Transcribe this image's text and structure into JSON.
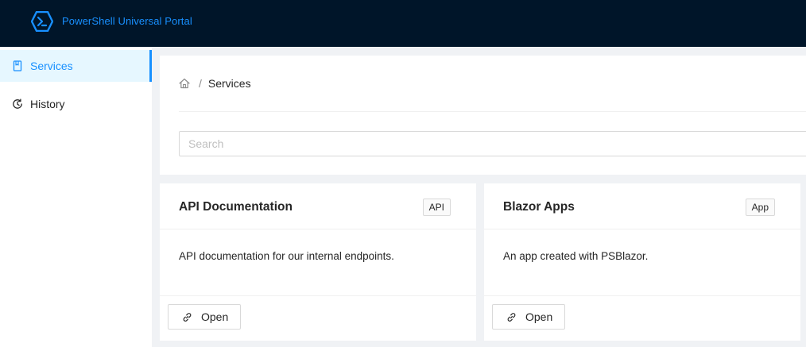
{
  "header": {
    "app_title": "PowerShell Universal Portal",
    "logo_icon": "powershell-hexagon-icon",
    "brand_color": "#1890ff",
    "background_color": "#001529"
  },
  "sidebar": {
    "items": [
      {
        "label": "Services",
        "icon": "book-icon",
        "active": true
      },
      {
        "label": "History",
        "icon": "history-icon",
        "active": false
      }
    ]
  },
  "breadcrumb": {
    "home_icon": "home-icon",
    "separator": "/",
    "current": "Services"
  },
  "search": {
    "placeholder": "Search",
    "value": ""
  },
  "cards": [
    {
      "title": "API Documentation",
      "tag": "API",
      "description": "API documentation for our internal endpoints.",
      "button_label": "Open",
      "button_icon": "link-icon"
    },
    {
      "title": "Blazor Apps",
      "tag": "App",
      "description": "An app created with PSBlazor.",
      "button_label": "Open",
      "button_icon": "link-icon"
    }
  ]
}
